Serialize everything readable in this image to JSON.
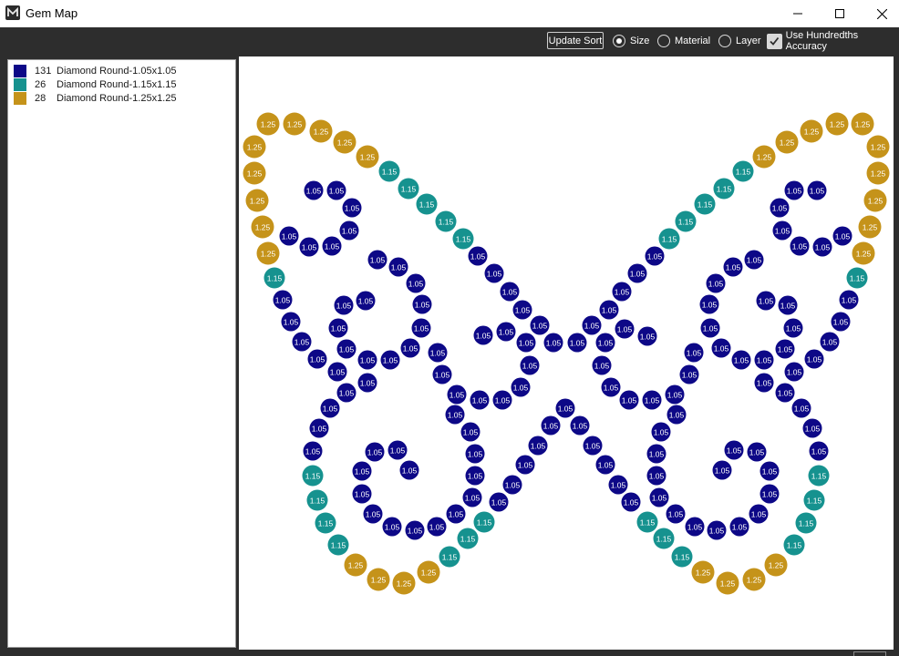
{
  "window": {
    "title": "Gem Map",
    "controls": {
      "minimize": "minimize",
      "maximize": "maximize",
      "close": "close"
    }
  },
  "toolbar": {
    "update_label": "Update Sort",
    "sort_options": [
      {
        "label": "Size",
        "selected": true
      },
      {
        "label": "Material",
        "selected": false
      },
      {
        "label": "Layer",
        "selected": false
      }
    ],
    "hundredths": {
      "label": "Use Hundredths Accuracy",
      "checked": true
    }
  },
  "legend": [
    {
      "count": "131",
      "name": "Diamond Round-1.05x1.05",
      "color": "#0d0887"
    },
    {
      "count": "26",
      "name": "Diamond Round-1.15x1.15",
      "color": "#16928f"
    },
    {
      "count": "28",
      "name": "Diamond Round-1.25x1.25",
      "color": "#c5931a"
    }
  ],
  "colors": {
    "chrome": "#2d2d2d",
    "gem_small": "#0d0887",
    "gem_medium": "#16928f",
    "gem_large": "#c5931a"
  },
  "gem_labels": {
    "small": "1.05",
    "medium": "1.15",
    "large": "1.25"
  }
}
